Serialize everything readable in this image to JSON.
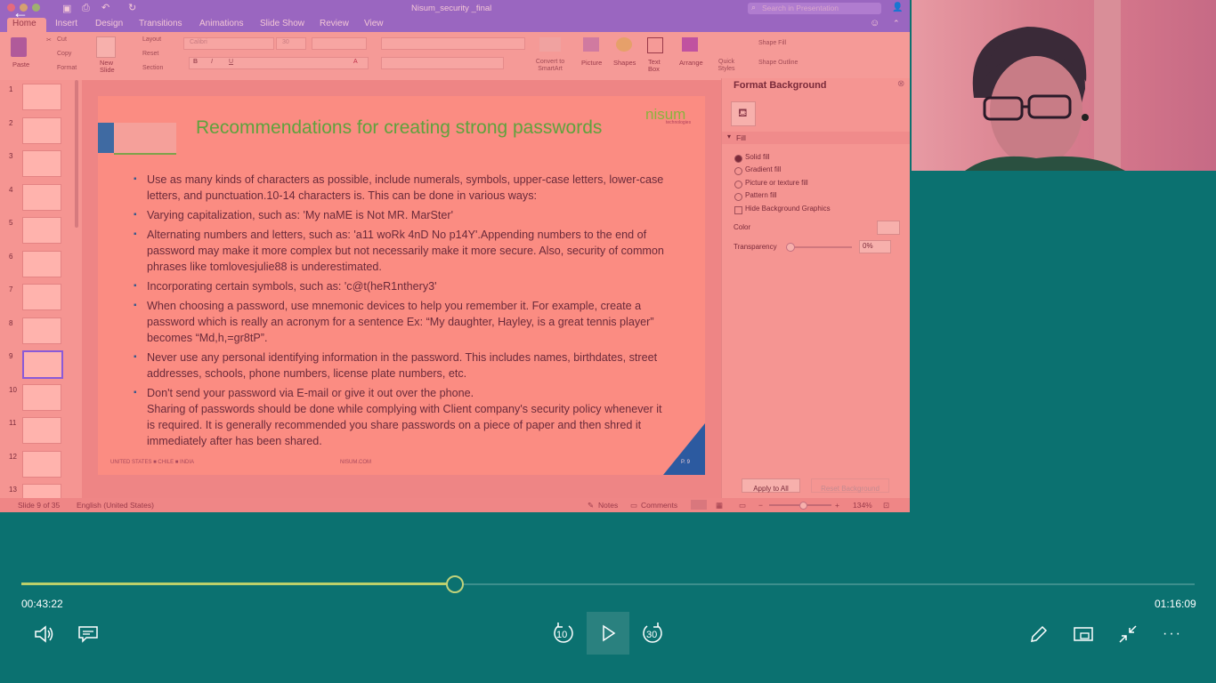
{
  "ppt": {
    "title": "Nisum_security _final",
    "search_placeholder": "Search in Presentation",
    "tabs": [
      "Home",
      "Insert",
      "Design",
      "Transitions",
      "Animations",
      "Slide Show",
      "Review",
      "View"
    ],
    "ribbon": {
      "paste": "Paste",
      "cut": "Cut",
      "copy": "Copy",
      "format": "Format",
      "new_slide": "New Slide",
      "layout": "Layout",
      "reset": "Reset",
      "section": "Section",
      "font_name": "Calibri",
      "font_size": "30",
      "convert_smartart": "Convert to SmartArt",
      "picture": "Picture",
      "shapes": "Shapes",
      "text_box": "Text Box",
      "arrange": "Arrange",
      "quick_styles": "Quick Styles",
      "shape_fill": "Shape Fill",
      "shape_outline": "Shape Outline"
    },
    "thumb_numbers": [
      "1",
      "2",
      "3",
      "4",
      "5",
      "6",
      "7",
      "8",
      "9",
      "10",
      "11",
      "12",
      "13"
    ],
    "slide": {
      "title": "Recommendations for creating strong passwords",
      "logo": "nisum",
      "logo_sub": "technologies",
      "bullets": [
        "Use as many kinds of characters as possible, include numerals, symbols, upper-case letters, lower-case letters, and punctuation.10-14 characters is. This can be done in various ways:",
        "Varying capitalization, such as: 'My naME is Not MR. MarSter'",
        "Alternating numbers and letters, such as: 'a11 woRk 4nD No p14Y'.Appending numbers to the end of password may make it more complex but not necessarily make it more secure. Also, security of common phrases like tomlovesjulie88 is underestimated.",
        "Incorporating certain symbols, such as: 'c@t(heR1nthery3'",
        "When choosing a password, use mnemonic devices to help you remember it. For example, create a password which is really an acronym for a sentence Ex: “My daughter, Hayley, is a great tennis player” becomes “Md,h,=gr8tP”.",
        "Never use any personal identifying information in the password. This includes names, birthdates, street addresses, schools, phone numbers, license plate numbers, etc.",
        "Don't send your password via E-mail or give it out over the phone.\nSharing of passwords should be done while complying with Client company's security policy whenever it is required. It is generally recommended you share passwords on a piece of paper and then shred it immediately after has been shared."
      ],
      "footer_countries": "UNITED STATES  ■  CHILE  ■  INDIA",
      "footer_site": "NISUM.COM",
      "page": "P. 9"
    },
    "format_panel": {
      "title": "Format Background",
      "section": "Fill",
      "options": [
        "Solid fill",
        "Gradient fill",
        "Picture or texture fill",
        "Pattern fill"
      ],
      "hide_graphics": "Hide Background Graphics",
      "color_label": "Color",
      "transparency_label": "Transparency",
      "transparency_value": "0%",
      "apply_all": "Apply to All",
      "reset_bg": "Reset Background"
    },
    "status": {
      "slide_of": "Slide 9 of 35",
      "language": "English (United States)",
      "notes": "Notes",
      "comments": "Comments",
      "zoom": "134%"
    }
  },
  "player": {
    "elapsed": "00:43:22",
    "total": "01:16:09",
    "progress_fraction": 0.3696,
    "skip_back": "10",
    "skip_fwd": "30"
  }
}
